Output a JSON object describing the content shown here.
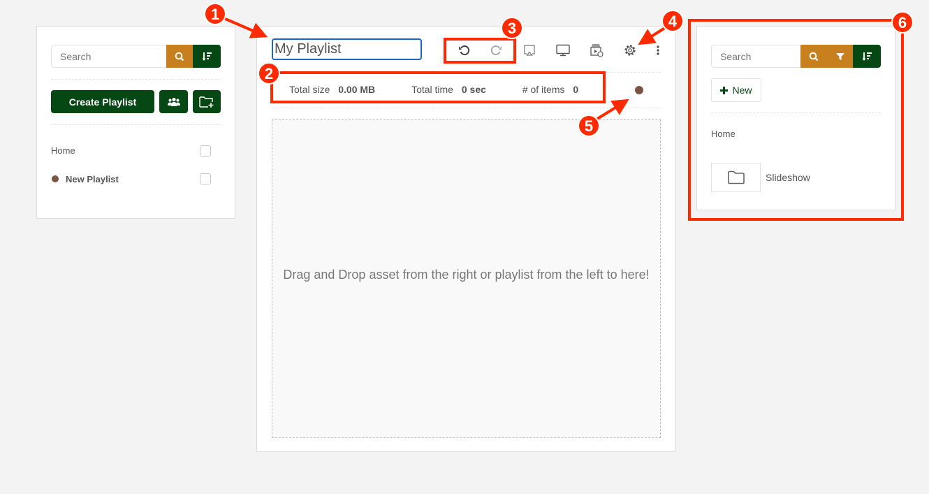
{
  "left": {
    "search_placeholder": "Search",
    "create_label": "Create Playlist",
    "items": [
      {
        "label": "Home"
      },
      {
        "label": "New Playlist",
        "dot_color": "#7a5444"
      }
    ]
  },
  "center": {
    "title_value": "My Playlist",
    "stats": {
      "size_label": "Total size",
      "size_value": "0.00 MB",
      "time_label": "Total time",
      "time_value": "0 sec",
      "items_label": "# of items",
      "items_value": "0"
    },
    "status_dot_color": "#7a5444",
    "drop_text": "Drag and Drop asset from the right or playlist from the left to here!"
  },
  "right": {
    "search_placeholder": "Search",
    "new_label": "New",
    "breadcrumb": "Home",
    "folders": [
      {
        "label": "Slideshow",
        "icon": "folder-icon"
      }
    ]
  },
  "colors": {
    "accent_gold": "#c8801e",
    "accent_green": "#064814",
    "annotation": "#ff2a00"
  },
  "annotations": [
    "1",
    "2",
    "3",
    "4",
    "5",
    "6"
  ]
}
